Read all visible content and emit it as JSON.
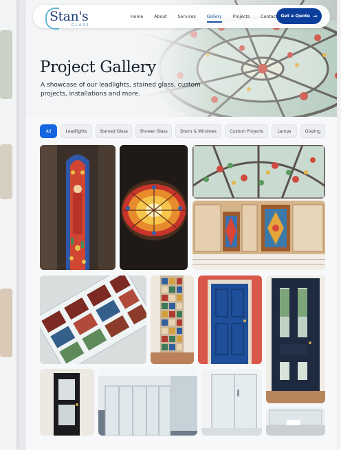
{
  "brand": {
    "name": "Stan's",
    "tagline": "GLASS"
  },
  "nav": {
    "items": [
      "Home",
      "About",
      "Services",
      "Gallery",
      "Projects",
      "Contact"
    ],
    "active": "Gallery",
    "cta_label": "Get a Quote"
  },
  "hero": {
    "title": "Project Gallery",
    "subtitle": "A showcase of our leadlights, stained glass, custom projects, installations and more."
  },
  "filters": {
    "items": [
      "All",
      "Leadlights",
      "Stained Glass",
      "Shower Glass",
      "Doors & Windows",
      "Custom Projects",
      "Lamps",
      "Glazing"
    ],
    "active": "All"
  },
  "colors": {
    "accent": "#1565e0",
    "cta": "#0c3f9c",
    "title": "#15202b"
  },
  "gallery": {
    "images": [
      "stained-glass-church-window",
      "round-stained-glass-ceiling-dome",
      "stained-glass-ceiling-panel",
      "kitchen-cabinets-with-leadlight-doors",
      "leadlight-panels-on-table",
      "mosaic-tile-column",
      "blue-front-door",
      "navy-door-with-glass-panels",
      "black-door-with-glass-insert",
      "frosted-glass-balcony-enclosure",
      "glass-shower-enclosure",
      "bathroom-vanity-with-glass"
    ]
  }
}
